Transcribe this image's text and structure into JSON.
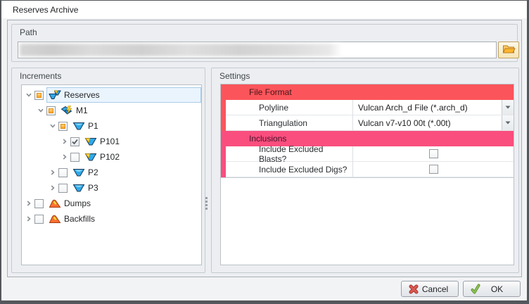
{
  "window": {
    "title": "Reserves Archive"
  },
  "path": {
    "group_label": "Path",
    "field_value": "",
    "browse_icon": "open-folder-icon"
  },
  "increments": {
    "group_label": "Increments",
    "tree": [
      {
        "label": "Reserves",
        "level": 0,
        "expander": "expanded",
        "checkbox": "indeterminate",
        "icon": "reserves-stack-icon",
        "selected": true
      },
      {
        "label": "M1",
        "level": 1,
        "expander": "expanded",
        "checkbox": "indeterminate",
        "icon": "model-icon",
        "selected": false
      },
      {
        "label": "P1",
        "level": 2,
        "expander": "expanded",
        "checkbox": "indeterminate",
        "icon": "pit-icon",
        "selected": false
      },
      {
        "label": "P101",
        "level": 3,
        "expander": "collapsed",
        "checkbox": "checked",
        "icon": "pit-stage-icon",
        "selected": false
      },
      {
        "label": "P102",
        "level": 3,
        "expander": "collapsed",
        "checkbox": "unchecked",
        "icon": "pit-stage-icon",
        "selected": false
      },
      {
        "label": "P2",
        "level": 2,
        "expander": "collapsed",
        "checkbox": "unchecked",
        "icon": "pit-icon",
        "selected": false
      },
      {
        "label": "P3",
        "level": 2,
        "expander": "collapsed",
        "checkbox": "unchecked",
        "icon": "pit-icon",
        "selected": false
      },
      {
        "label": "Dumps",
        "level": 0,
        "expander": "collapsed",
        "checkbox": "unchecked",
        "icon": "dump-icon",
        "selected": false
      },
      {
        "label": "Backfills",
        "level": 0,
        "expander": "collapsed",
        "checkbox": "unchecked",
        "icon": "dump-icon",
        "selected": false
      }
    ]
  },
  "settings": {
    "group_label": "Settings",
    "sections": [
      {
        "header": "File Format",
        "accent": "#FB555B",
        "header_text_color": "#441518",
        "rows": [
          {
            "label": "Polyline",
            "type": "dropdown",
            "value": "Vulcan Arch_d File (*.arch_d)"
          },
          {
            "label": "Triangulation",
            "type": "dropdown",
            "value": "Vulcan v7-v10 00t (*.00t)"
          }
        ]
      },
      {
        "header": "Inclusions",
        "accent": "#F94E7E",
        "header_text_color": "#44142A",
        "rows": [
          {
            "label": "Include Excluded Blasts?",
            "type": "checkbox",
            "value": false
          },
          {
            "label": "Include Excluded Digs?",
            "type": "checkbox",
            "value": false
          }
        ]
      }
    ]
  },
  "footer": {
    "cancel_label": "Cancel",
    "ok_label": "OK"
  }
}
